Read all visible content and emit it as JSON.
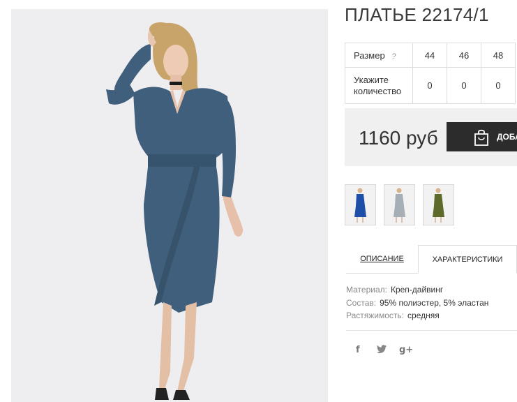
{
  "product": {
    "title": "ПЛАТЬЕ 22174/1",
    "price": "1160 руб",
    "add_to_cart_label": "ДОБАВИТЬ",
    "colors": {
      "dress": "#3f5f7c",
      "accent_dark": "#2c2c2c"
    }
  },
  "sizes": {
    "row_label": "Размер",
    "help": "?",
    "qty_label_line1": "Укажите",
    "qty_label_line2": "количество",
    "items": [
      {
        "size": "44",
        "qty": "0"
      },
      {
        "size": "46",
        "qty": "0"
      },
      {
        "size": "48",
        "qty": "0"
      }
    ]
  },
  "thumbnails": [
    {
      "name": "thumb-blue",
      "color": "#1e4fa8"
    },
    {
      "name": "thumb-grey",
      "color": "#a6aeb6"
    },
    {
      "name": "thumb-olive",
      "color": "#5e6a2a"
    }
  ],
  "tabs": {
    "description": "ОПИСАНИЕ",
    "characteristics": "ХАРАКТЕРИСТИКИ"
  },
  "properties": [
    {
      "key": "Материал:",
      "value": "Креп-дайвинг"
    },
    {
      "key": "Состав:",
      "value": "95% полиэстер, 5% эластан"
    },
    {
      "key": "Растяжимость:",
      "value": "средняя"
    }
  ],
  "social": {
    "facebook": "f",
    "twitter_icon": "twitter-bird",
    "googleplus": "g+"
  }
}
